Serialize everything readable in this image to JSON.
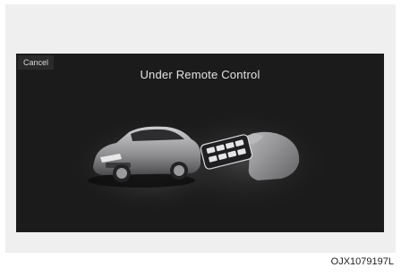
{
  "screen": {
    "cancel_label": "Cancel",
    "title": "Under Remote Control"
  },
  "figure_code": "OJX1079197L",
  "colors": {
    "screen_background": "#1b1b1c",
    "frame_background": "#efeff0",
    "text": "#e4e4e4"
  },
  "icons": [
    "car-illustration",
    "smart-key-remote-icon",
    "hand-icon"
  ]
}
